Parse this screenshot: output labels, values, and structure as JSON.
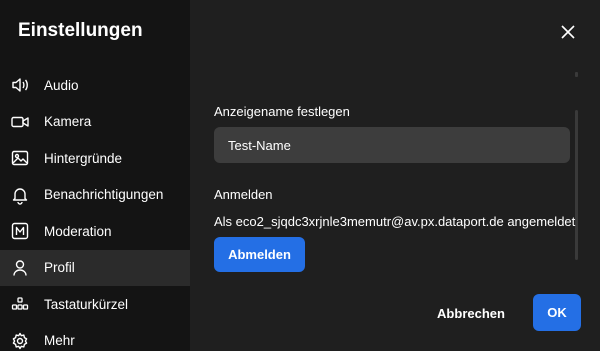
{
  "sidebar": {
    "title": "Einstellungen",
    "items": [
      {
        "label": "Audio",
        "icon": "speaker-icon"
      },
      {
        "label": "Kamera",
        "icon": "video-camera-icon"
      },
      {
        "label": "Hintergründe",
        "icon": "image-icon"
      },
      {
        "label": "Benachrichtigungen",
        "icon": "bell-icon"
      },
      {
        "label": "Moderation",
        "icon": "moderator-icon"
      },
      {
        "label": "Profil",
        "icon": "user-icon"
      },
      {
        "label": "Tastaturkürzel",
        "icon": "keyboard-shortcuts-icon"
      },
      {
        "label": "Mehr",
        "icon": "gear-icon"
      }
    ],
    "selected_index": 5
  },
  "main": {
    "display_name_label": "Anzeigename festlegen",
    "display_name_value": "Test-Name",
    "login_label": "Anmelden",
    "login_status": "Als eco2_sjqdc3xrjnle3memutr@av.px.dataport.de angemeldet",
    "logout_button": "Abmelden"
  },
  "footer": {
    "cancel_button": "Abbrechen",
    "ok_button": "OK"
  },
  "colors": {
    "accent": "#246fe5",
    "sidebar_bg": "#141414",
    "main_bg": "#1f1f1f",
    "selected_bg": "#2b2b2b",
    "input_bg": "#3d3d3d"
  }
}
